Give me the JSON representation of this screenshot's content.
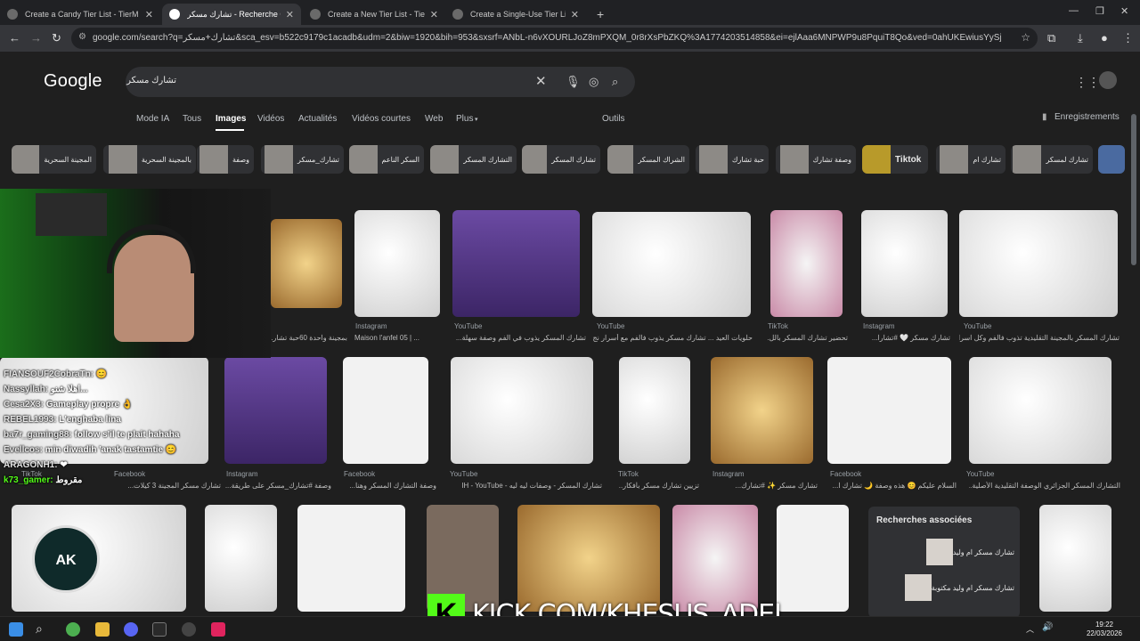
{
  "tabs": [
    {
      "title": "Create a Candy Tier List - TierM"
    },
    {
      "title": "تشارك مسكر - Recherche Google"
    },
    {
      "title": "Create a New Tier List - TierMa"
    },
    {
      "title": "Create a Single-Use Tier List (P"
    }
  ],
  "address": {
    "url": "google.com/search?q=تشارك+مسكر&sca_esv=b522c9179c1acadb&udm=2&biw=1920&bih=953&sxsrf=ANbL-n6vXOURLJoZ8mPXQM_0r8rXsPbZKQ%3A1774203514858&ei=ejlAaa6MNPWP9u8PquiT8Qo&ved=0ahUKEwiusYySj7STAxX1h_0HHSr0JK..."
  },
  "google": {
    "logo": "Google",
    "query": "تشارك مسكر",
    "filters": [
      "Mode IA",
      "Tous",
      "Images",
      "Vidéos",
      "Actualités",
      "Vidéos courtes",
      "Web",
      "Plus"
    ],
    "tools": "Outils",
    "saved": "Enregistrements"
  },
  "chips": [
    "المجينة السحرية",
    "بالمجينة السحرية",
    "وصفة",
    "تشارك_مسكر",
    "السكر الناعم",
    "التشارك المسكر",
    "تشارك المسكر",
    "الشراك المسكر",
    "حبة تشارك",
    "وصفة تشارك",
    "Tiktok",
    "تشارك ام",
    "تشارك لمسكر"
  ],
  "row1": [
    {
      "src": "",
      "caption": "بمجينة واحدة 60حبة تشار..."
    },
    {
      "src": "Instagram",
      "caption": "Maison l'anfel 05 | ..."
    },
    {
      "src": "YouTube",
      "caption": "تشارك المسكر يذوب في الفم وصفة سهلة..."
    },
    {
      "src": "YouTube",
      "caption": "حلويات العيد ... تشارك مسكر يذوب فالفم مع أسرار نج..."
    },
    {
      "src": "TikTok",
      "caption": "تحضير تشارك المسكر بالل..."
    },
    {
      "src": "Instagram",
      "caption": "تشارك مسكر 🤍 #تشارا..."
    },
    {
      "src": "YouTube",
      "caption": "تشارك المسكر بالمجينة التقليدية تذوب فالفم وكل اسرا..."
    }
  ],
  "row2": [
    {
      "src": "TikTok",
      "caption": ""
    },
    {
      "src": "Facebook",
      "caption": "تشارك مسكر المجينة 3 كيلات..."
    },
    {
      "src": "Instagram",
      "caption": "وصفة #تشارك_مسكر على طريقة..."
    },
    {
      "src": "Facebook",
      "caption": "وصفة التشارك المسكر وهنا..."
    },
    {
      "src": "YouTube",
      "caption": "تشارك المسكر - وصفات ليه ليه - IH - YouTube"
    },
    {
      "src": "TikTok",
      "caption": "تزيين تشارك مسكر بأفكار..."
    },
    {
      "src": "Instagram",
      "caption": "تشارك مسكر ✨ #تشارك..."
    },
    {
      "src": "Facebook",
      "caption": "السلام عليكم 😊 هذه وصفة 🌙 تشارك ا..."
    },
    {
      "src": "YouTube",
      "caption": "التشارك المسكر الجزائري الوصفة التقليدية الأصلية..."
    }
  ],
  "related": {
    "title": "Recherches associées",
    "items": [
      "تشارك مسكر ام وليد",
      "تشارك مسكر ام وليد مكتوبة"
    ]
  },
  "chat": [
    {
      "user": "FIANSOUF2CobraTn:",
      "msg": "😊"
    },
    {
      "user": "Nassyllah:",
      "msg": "اهلا شنو..."
    },
    {
      "user": "Cesa2X3:",
      "msg": "Gameplay propre 👌"
    },
    {
      "user": "REBEL1993:",
      "msg": "L'enghaba lina"
    },
    {
      "user": "ba7r_gaming88:",
      "msg": "follow s'il te plait hahaha"
    },
    {
      "user": "Evellcos:",
      "msg": "min diwadih 'anak tastamtie 😊"
    },
    {
      "user": "ARAGONH1:",
      "msg": "❤"
    },
    {
      "user": "k73_gamer:",
      "msg": "مقروط"
    }
  ],
  "stream": {
    "logo_text": "AK",
    "kick_text": "KICK.COM/KHESUS_ADEL"
  },
  "clock": {
    "time": "19:22",
    "date": "22/03/2026"
  }
}
